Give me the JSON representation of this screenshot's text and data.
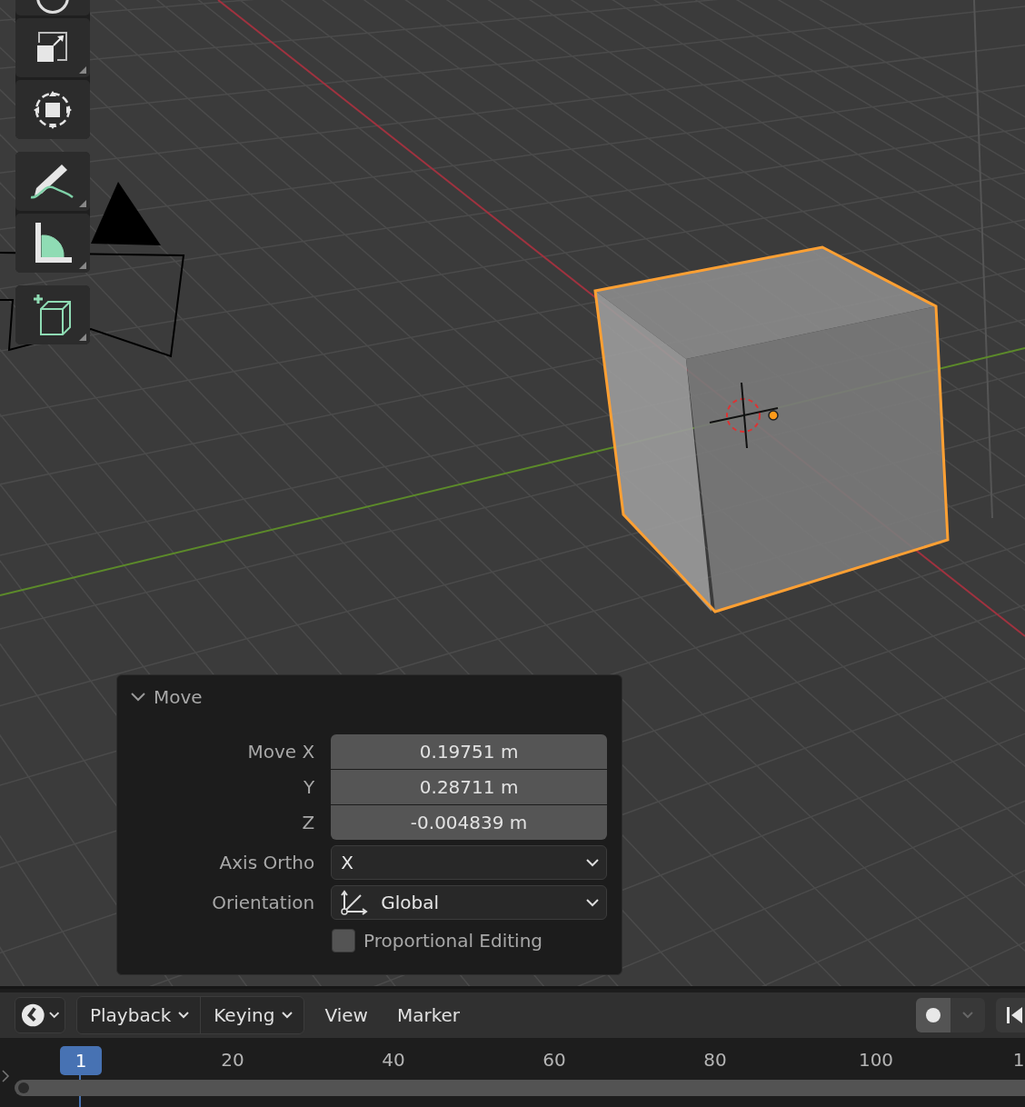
{
  "toolbar": {
    "groups": [
      [
        {
          "kind": "rotate"
        },
        {
          "kind": "scale"
        },
        {
          "kind": "transform"
        }
      ],
      [
        {
          "kind": "annotate"
        },
        {
          "kind": "measure"
        }
      ],
      [
        {
          "kind": "add_cube"
        }
      ]
    ]
  },
  "operator_panel": {
    "title": "Move",
    "expanded": true,
    "vector": [
      {
        "label": "Move X",
        "value": "0.19751 m"
      },
      {
        "label": "Y",
        "value": "0.28711 m"
      },
      {
        "label": "Z",
        "value": "-0.004839 m"
      }
    ],
    "axis_ortho": {
      "label": "Axis Ortho",
      "value": "X"
    },
    "orientation": {
      "label": "Orientation",
      "value": "Global"
    },
    "proportional_editing": {
      "label": "Proportional Editing",
      "checked": false
    }
  },
  "timeline": {
    "menus": [
      {
        "label": "Playback",
        "dropdown": true
      },
      {
        "label": "Keying",
        "dropdown": true
      },
      {
        "label": "View",
        "dropdown": false
      },
      {
        "label": "Marker",
        "dropdown": false
      }
    ],
    "auto_keying": false,
    "current_frame": "1",
    "frame_labels": [
      "20",
      "40",
      "60",
      "80",
      "100",
      "1"
    ]
  }
}
